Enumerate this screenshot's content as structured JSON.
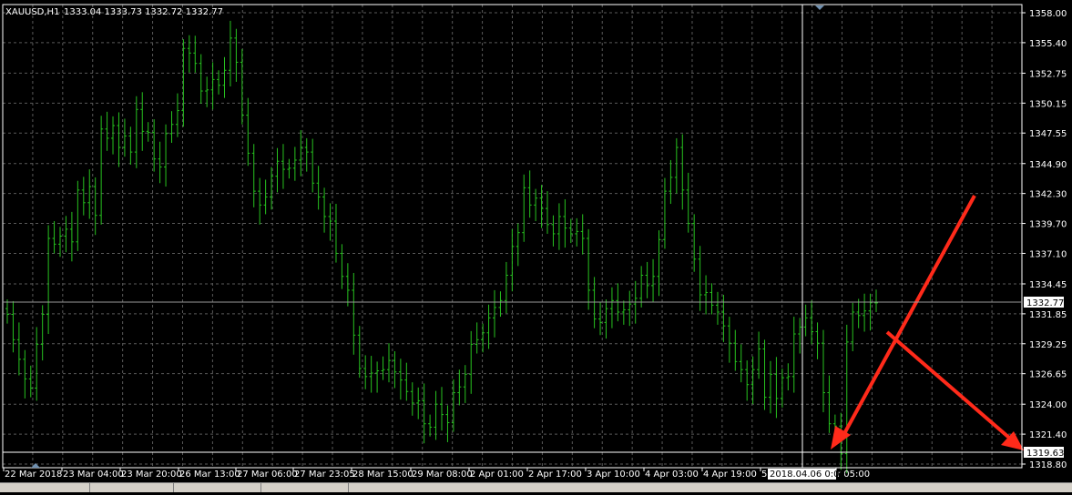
{
  "header": {
    "symbol_timeframe": "XAUUSD,H1",
    "ohlc": "1333.04 1333.73 1332.72 1332.77"
  },
  "colors": {
    "background": "#000000",
    "grid": "#5a5a5a",
    "candle": "#27c21f",
    "axis": "#ffffff",
    "arrow": "#ff2a1a"
  },
  "price_axis": {
    "ticks": [
      "1358.00",
      "1355.40",
      "1352.75",
      "1350.15",
      "1347.55",
      "1344.90",
      "1342.30",
      "1339.70",
      "1337.10",
      "1334.45",
      "1331.85",
      "1329.25",
      "1326.65",
      "1324.00",
      "1321.40",
      "1318.80"
    ],
    "current_price": "1332.77",
    "crosshair_price": "1319.63"
  },
  "time_axis": {
    "labels": [
      "22 Mar 2018",
      "23 Mar 04:00",
      "23 Mar 20:00",
      "26 Mar 13:00",
      "27 Mar 06:00",
      "27 Mar 23:05",
      "28 Mar 15:00",
      "29 Mar 08:00",
      "2 Apr 01:00",
      "2 Apr 17:00",
      "3 Apr 10:00",
      "4 Apr 03:00",
      "4 Apr 19:00",
      "5",
      "r 05:00"
    ],
    "crosshair_time": "2018.04.06 0:00"
  },
  "chart_data": {
    "type": "candlestick",
    "symbol": "XAUUSD",
    "timeframe": "H1",
    "ylim": [
      1318.8,
      1358.0
    ],
    "grid": true,
    "closes": [
      1331.8,
      1329.6,
      1327.9,
      1326.2,
      1325.4,
      1329.2,
      1331.8,
      1338.4,
      1337.9,
      1338.6,
      1339.2,
      1338.1,
      1342.6,
      1341.5,
      1342.9,
      1340.4,
      1347.9,
      1347.1,
      1348.2,
      1346.3,
      1347.3,
      1345.9,
      1349.6,
      1347.7,
      1347.6,
      1345.3,
      1344.6,
      1347.5,
      1348.3,
      1349.5,
      1354.9,
      1354.5,
      1353.6,
      1351.2,
      1351.3,
      1352.2,
      1351.7,
      1353.0,
      1355.8,
      1353.7,
      1349.1,
      1345.8,
      1342.5,
      1341.3,
      1342.0,
      1343.8,
      1345.1,
      1344.4,
      1344.5,
      1345.2,
      1346.3,
      1345.9,
      1343.2,
      1342.0,
      1340.3,
      1339.9,
      1337.1,
      1335.1,
      1333.9,
      1330.0,
      1327.1,
      1326.4,
      1326.7,
      1326.9,
      1327.0,
      1327.8,
      1326.8,
      1326.1,
      1325.1,
      1324.1,
      1324.3,
      1322.3,
      1322.0,
      1324.0,
      1323.1,
      1322.4,
      1325.0,
      1325.5,
      1326.6,
      1329.2,
      1329.6,
      1330.2,
      1331.5,
      1332.4,
      1333.0,
      1335.2,
      1337.7,
      1338.9,
      1342.8,
      1341.3,
      1341.9,
      1341.0,
      1339.6,
      1338.8,
      1340.3,
      1339.3,
      1338.8,
      1339.0,
      1338.4,
      1333.9,
      1331.4,
      1331.1,
      1332.3,
      1333.0,
      1332.0,
      1332.2,
      1332.7,
      1333.2,
      1335.2,
      1334.3,
      1335.1,
      1338.3,
      1342.5,
      1343.7,
      1346.3,
      1342.6,
      1339.7,
      1336.6,
      1333.5,
      1333.7,
      1332.6,
      1332.0,
      1330.8,
      1329.3,
      1327.7,
      1327.0,
      1325.7,
      1327.0,
      1328.8,
      1324.6,
      1326.6,
      1324.5,
      1326.3,
      1326.4,
      1330.1,
      1330.7,
      1331.5,
      1330.3,
      1329.3,
      1325.0,
      1322.3,
      1322.1,
      1319.7,
      1329.4,
      1332.0,
      1331.7,
      1332.1,
      1332.8,
      1332.8
    ]
  }
}
